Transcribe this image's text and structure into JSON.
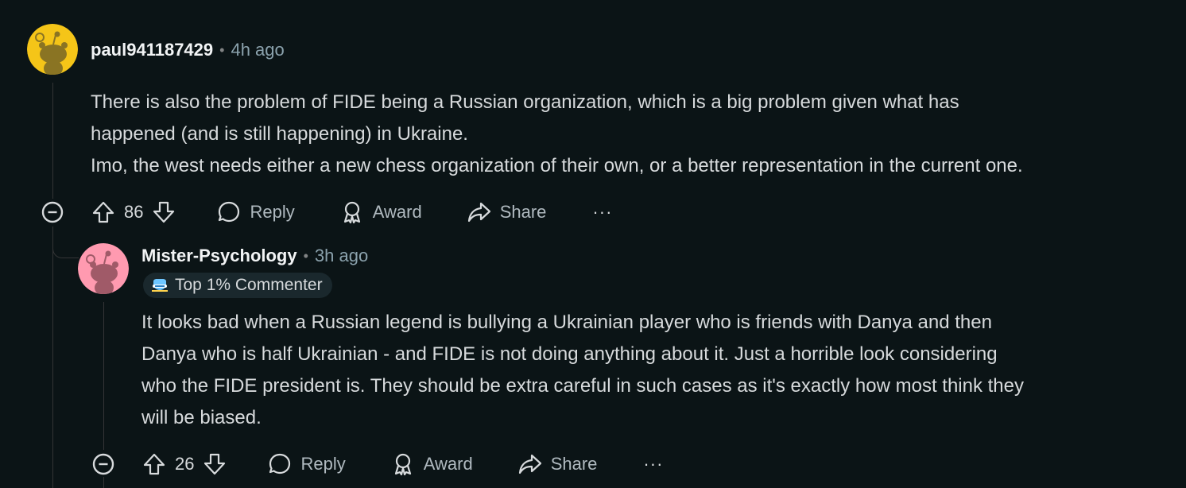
{
  "colors": {
    "background": "#0b1416",
    "text": "#d7dadc",
    "muted": "#8ba2ad",
    "thread": "#343536",
    "avatar_yellow": "#f5c518",
    "avatar_pink": "#ff9ab0"
  },
  "comments": [
    {
      "username": "paul941187429",
      "separator": "•",
      "time": "4h ago",
      "avatar_icon": "snoo-avatar-icon",
      "body": [
        "There is also the problem of FIDE being a Russian organization, which is a big problem given what has",
        "happened (and is still happening) in Ukraine.",
        "Imo, the west needs either a new chess organization of their own, or a better representation in the current one."
      ],
      "votes": "86",
      "actions": {
        "reply": "Reply",
        "award": "Award",
        "share": "Share",
        "more": "···"
      }
    },
    {
      "username": "Mister-Psychology",
      "separator": "•",
      "time": "3h ago",
      "avatar_icon": "snoo-avatar-icon",
      "flair": "Top 1% Commenter",
      "flair_icon": "top-commenter-icon",
      "body": [
        "It looks bad when a Russian legend is bullying a Ukrainian player who is friends with Danya and then",
        "Danya who is half Ukrainian - and FIDE is not doing anything about it. Just a horrible look considering",
        "who the FIDE president is. They should be extra careful in such cases as it's exactly how most think they",
        "will be biased."
      ],
      "votes": "26",
      "actions": {
        "reply": "Reply",
        "award": "Award",
        "share": "Share",
        "more": "···"
      }
    }
  ]
}
